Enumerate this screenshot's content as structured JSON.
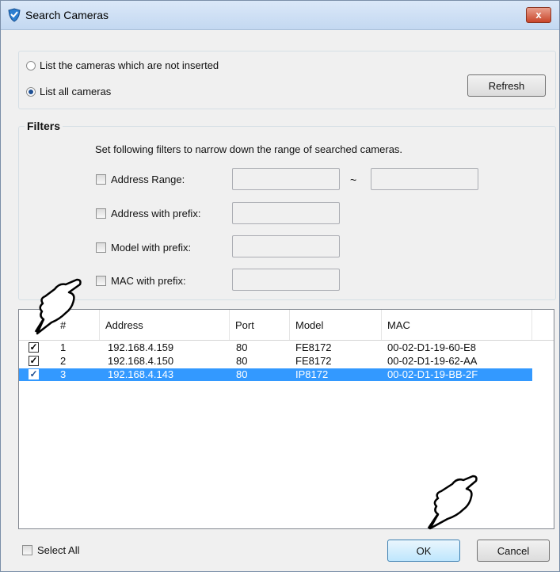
{
  "window": {
    "title": "Search Cameras",
    "close_label": "x"
  },
  "list_options": {
    "not_inserted_label": "List the cameras which are not inserted",
    "all_label": "List all cameras",
    "refresh_label": "Refresh"
  },
  "filters": {
    "legend": "Filters",
    "description": "Set following filters to narrow down the range of searched cameras.",
    "address_range_label": "Address Range:",
    "range_separator": "~",
    "address_prefix_label": "Address with prefix:",
    "model_prefix_label": "Model with prefix:",
    "mac_prefix_label": "MAC with prefix:"
  },
  "table": {
    "columns": [
      "#",
      "Address",
      "Port",
      "Model",
      "MAC"
    ],
    "rows": [
      {
        "num": "1",
        "address": "192.168.4.159",
        "port": "80",
        "model": "FE8172",
        "mac": "00-02-D1-19-60-E8"
      },
      {
        "num": "2",
        "address": "192.168.4.150",
        "port": "80",
        "model": "FE8172",
        "mac": "00-02-D1-19-62-AA"
      },
      {
        "num": "3",
        "address": "192.168.4.143",
        "port": "80",
        "model": "IP8172",
        "mac": "00-02-D1-19-BB-2F"
      }
    ]
  },
  "footer": {
    "select_all_label": "Select All",
    "ok_label": "OK",
    "cancel_label": "Cancel"
  },
  "colors": {
    "selection": "#3399ff",
    "titlebar": "#c3d8f1",
    "close_button": "#c9452a"
  },
  "icons": [
    "app-shield-icon",
    "close-icon",
    "pointing-hand-icon"
  ]
}
